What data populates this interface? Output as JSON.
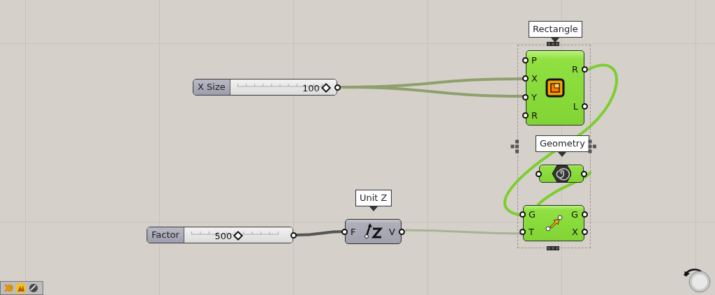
{
  "sliders": [
    {
      "label": "X Size",
      "value": "100",
      "level": 0.9
    },
    {
      "label": "Factor",
      "value": "500",
      "level": 0.5
    }
  ],
  "components": [
    {
      "kind": "rectangle",
      "tooltip": "Rectangle",
      "inputs": [
        "P",
        "X",
        "Y",
        "R"
      ],
      "outputs": [
        "R",
        "L"
      ],
      "selected": true
    },
    {
      "kind": "param",
      "tooltip": "Geometry",
      "selected": true
    },
    {
      "kind": "unitz",
      "tooltip": "Unit Z",
      "inputs": [
        "F"
      ],
      "outputs": [
        "V"
      ],
      "selected": false
    },
    {
      "kind": "move",
      "inputs": [
        "G",
        "T"
      ],
      "outputs": [
        "G",
        "X"
      ],
      "selected": true
    }
  ]
}
